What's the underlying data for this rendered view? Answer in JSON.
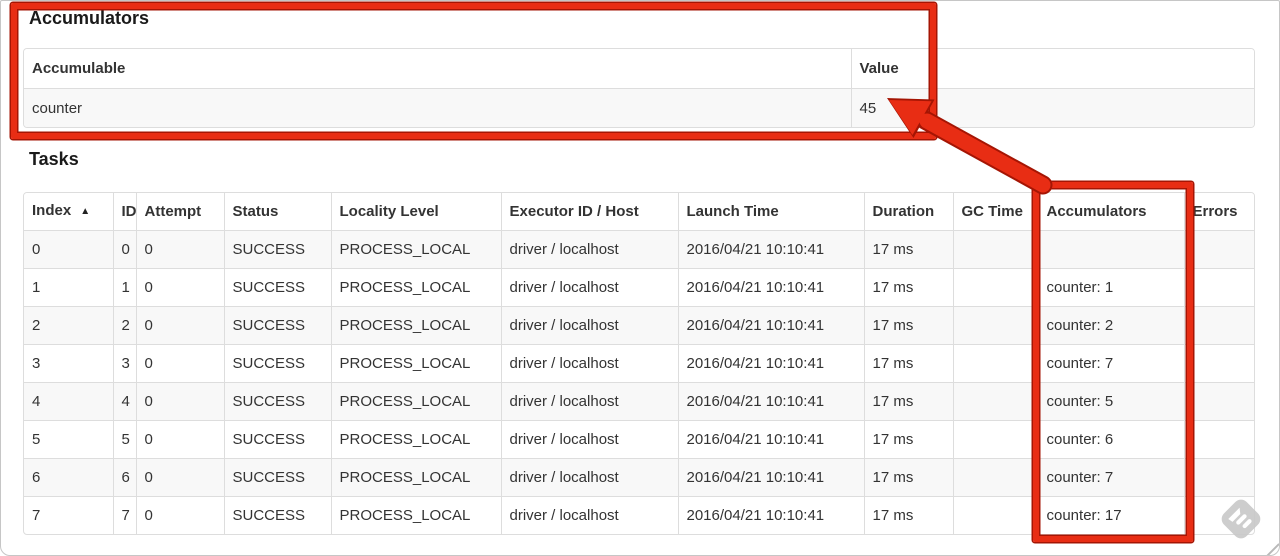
{
  "accumulators_section": {
    "heading": "Accumulators",
    "table": {
      "headers": [
        "Accumulable",
        "Value"
      ],
      "rows": [
        [
          "counter",
          "45"
        ]
      ]
    }
  },
  "tasks_section": {
    "heading": "Tasks",
    "table": {
      "headers": [
        "Index",
        "ID",
        "Attempt",
        "Status",
        "Locality Level",
        "Executor ID / Host",
        "Launch Time",
        "Duration",
        "GC Time",
        "Accumulators",
        "Errors"
      ],
      "sort_icon": "▲",
      "sorted_column": "Index",
      "rows": [
        [
          "0",
          "0",
          "0",
          "SUCCESS",
          "PROCESS_LOCAL",
          "driver / localhost",
          "2016/04/21 10:10:41",
          "17 ms",
          "",
          "",
          ""
        ],
        [
          "1",
          "1",
          "0",
          "SUCCESS",
          "PROCESS_LOCAL",
          "driver / localhost",
          "2016/04/21 10:10:41",
          "17 ms",
          "",
          "counter: 1",
          ""
        ],
        [
          "2",
          "2",
          "0",
          "SUCCESS",
          "PROCESS_LOCAL",
          "driver / localhost",
          "2016/04/21 10:10:41",
          "17 ms",
          "",
          "counter: 2",
          ""
        ],
        [
          "3",
          "3",
          "0",
          "SUCCESS",
          "PROCESS_LOCAL",
          "driver / localhost",
          "2016/04/21 10:10:41",
          "17 ms",
          "",
          "counter: 7",
          ""
        ],
        [
          "4",
          "4",
          "0",
          "SUCCESS",
          "PROCESS_LOCAL",
          "driver / localhost",
          "2016/04/21 10:10:41",
          "17 ms",
          "",
          "counter: 5",
          ""
        ],
        [
          "5",
          "5",
          "0",
          "SUCCESS",
          "PROCESS_LOCAL",
          "driver / localhost",
          "2016/04/21 10:10:41",
          "17 ms",
          "",
          "counter: 6",
          ""
        ],
        [
          "6",
          "6",
          "0",
          "SUCCESS",
          "PROCESS_LOCAL",
          "driver / localhost",
          "2016/04/21 10:10:41",
          "17 ms",
          "",
          "counter: 7",
          ""
        ],
        [
          "7",
          "7",
          "0",
          "SUCCESS",
          "PROCESS_LOCAL",
          "driver / localhost",
          "2016/04/21 10:10:41",
          "17 ms",
          "",
          "counter: 17",
          ""
        ]
      ]
    }
  },
  "annotations": {
    "highlight_color": "#e82d14",
    "outline_color": "#a51504",
    "boxes": [
      "accumulators-summary",
      "tasks-accumulators-column"
    ],
    "arrow": "points from tasks accumulators column to accumulator total value 45"
  },
  "watermark": {
    "icon": "skitch-watermark"
  }
}
